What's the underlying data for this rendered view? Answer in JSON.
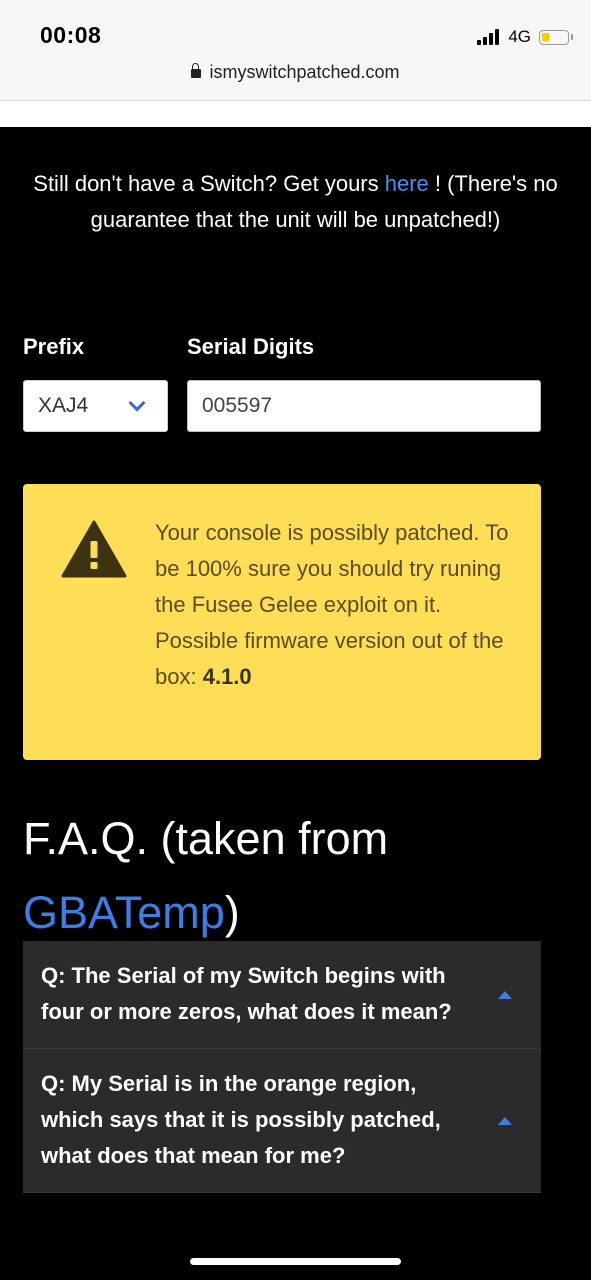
{
  "status_bar": {
    "time": "00:08",
    "network": "4G",
    "battery_level": 0.2
  },
  "browser": {
    "url": "ismyswitchpatched.com"
  },
  "promo": {
    "text_before": "Still don't have a Switch? Get yours ",
    "link": "here",
    "text_after": " ! (There's no guarantee that the unit will be unpatched!)"
  },
  "form": {
    "prefix_label": "Prefix",
    "prefix_value": "XAJ4",
    "serial_label": "Serial Digits",
    "serial_value": "005597"
  },
  "warning": {
    "message": "Your console is possibly patched. To be 100% sure you should try runing the Fusee Gelee exploit on it. Possible firmware version out of the box: ",
    "firmware": "4.1.0",
    "color": "#fedd57"
  },
  "faq": {
    "title": "F.A.Q. (taken from ",
    "title_link": "GBATemp",
    "title_end": ")",
    "items": [
      {
        "question": "Q: The Serial of my Switch begins with four or more zeros, what does it mean?"
      },
      {
        "question": "Q: My Serial is in the orange region, which says that it is possibly patched, what does that mean for me?"
      }
    ]
  },
  "colors": {
    "link": "#4a8ff0",
    "accent": "#3d7ee6"
  }
}
